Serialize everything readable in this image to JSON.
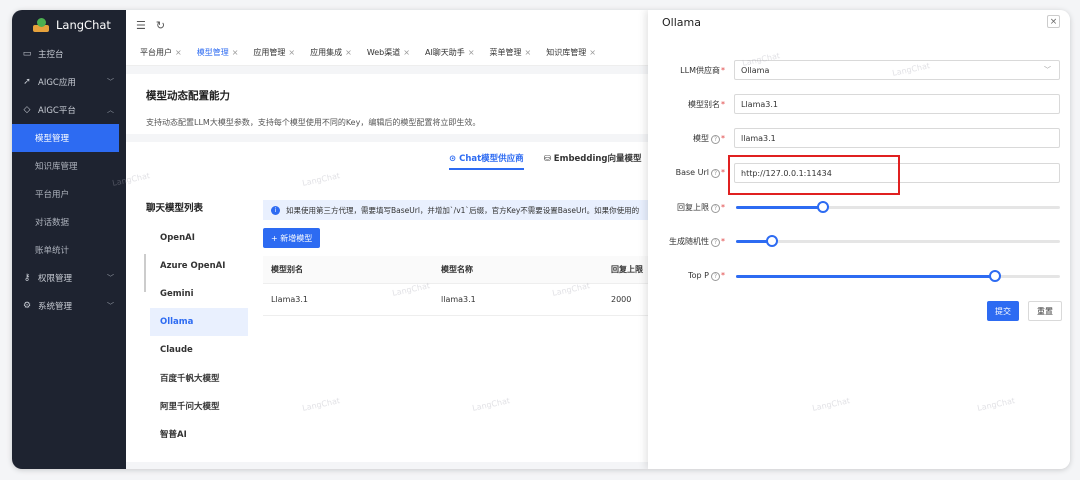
{
  "app": {
    "name": "LangChat",
    "watermark": "LangChat"
  },
  "sidebar": {
    "items": [
      {
        "icon": "monitor-icon",
        "glyph": "▭",
        "label": "主控台"
      },
      {
        "icon": "send-icon",
        "glyph": "➚",
        "label": "AIGC应用",
        "expandable": true
      },
      {
        "icon": "cube-icon",
        "glyph": "◇",
        "label": "AIGC平台",
        "expanded": true
      }
    ],
    "sub_items": [
      "模型管理",
      "知识库管理",
      "平台用户",
      "对话数据",
      "账单统计"
    ],
    "active_sub": "模型管理",
    "bottom_items": [
      {
        "icon": "key-icon",
        "glyph": "⚷",
        "label": "权限管理"
      },
      {
        "icon": "gear-icon",
        "glyph": "⚙",
        "label": "系统管理"
      }
    ]
  },
  "topbar": {
    "menu_glyph": "☰",
    "refresh_glyph": "↻"
  },
  "tabs": [
    {
      "label": "平台用户",
      "active": false
    },
    {
      "label": "模型管理",
      "active": true
    },
    {
      "label": "应用管理",
      "active": false
    },
    {
      "label": "应用集成",
      "active": false
    },
    {
      "label": "Web渠道",
      "active": false
    },
    {
      "label": "AI聊天助手",
      "active": false
    },
    {
      "label": "菜单管理",
      "active": false
    },
    {
      "label": "知识库管理",
      "active": false
    }
  ],
  "tab_close": "×",
  "page": {
    "title": "模型动态配置能力",
    "description": "支持动态配置LLM大模型参数，支持每个模型使用不同的Key，编辑后的模型配置将立即生效。"
  },
  "model_tabs": [
    {
      "icon": "chat-icon",
      "label": "Chat模型供应商",
      "active": true
    },
    {
      "icon": "database-icon",
      "label": "Embedding向量模型",
      "active": false
    }
  ],
  "providers_title": "聊天模型列表",
  "providers": [
    "OpenAI",
    "Azure OpenAI",
    "Gemini",
    "Ollama",
    "Claude",
    "百度千帆大模型",
    "阿里千问大模型",
    "智普AI"
  ],
  "active_provider": "Ollama",
  "info_text": "如果使用第三方代理，需要填写BaseUrl，并增加`/v1`后缀，官方Key不需要设置BaseUrl。如果你使用的",
  "add_button": "+ 新增模型",
  "table": {
    "headers": [
      "模型别名",
      "模型名称",
      "回复上限"
    ],
    "rows": [
      [
        "Llama3.1",
        "llama3.1",
        "2000"
      ]
    ]
  },
  "drawer": {
    "title": "Ollama",
    "close": "×",
    "fields": {
      "provider": {
        "label": "LLM供应商",
        "value": "Ollama"
      },
      "alias": {
        "label": "模型别名",
        "value": "Llama3.1"
      },
      "model": {
        "label": "模型",
        "value": "llama3.1"
      },
      "base_url": {
        "label": "Base Url",
        "value": "http://127.0.0.1:11434"
      },
      "max_reply": {
        "label": "回复上限",
        "level": 0.27
      },
      "temperature": {
        "label": "生成随机性",
        "level": 0.11
      },
      "top_p": {
        "label": "Top P",
        "level": 0.8
      }
    },
    "submit": "提交",
    "reset": "重置"
  },
  "colors": {
    "accent": "#2d6bf2",
    "sidebar": "#1e2330",
    "highlight": "#e02020"
  }
}
